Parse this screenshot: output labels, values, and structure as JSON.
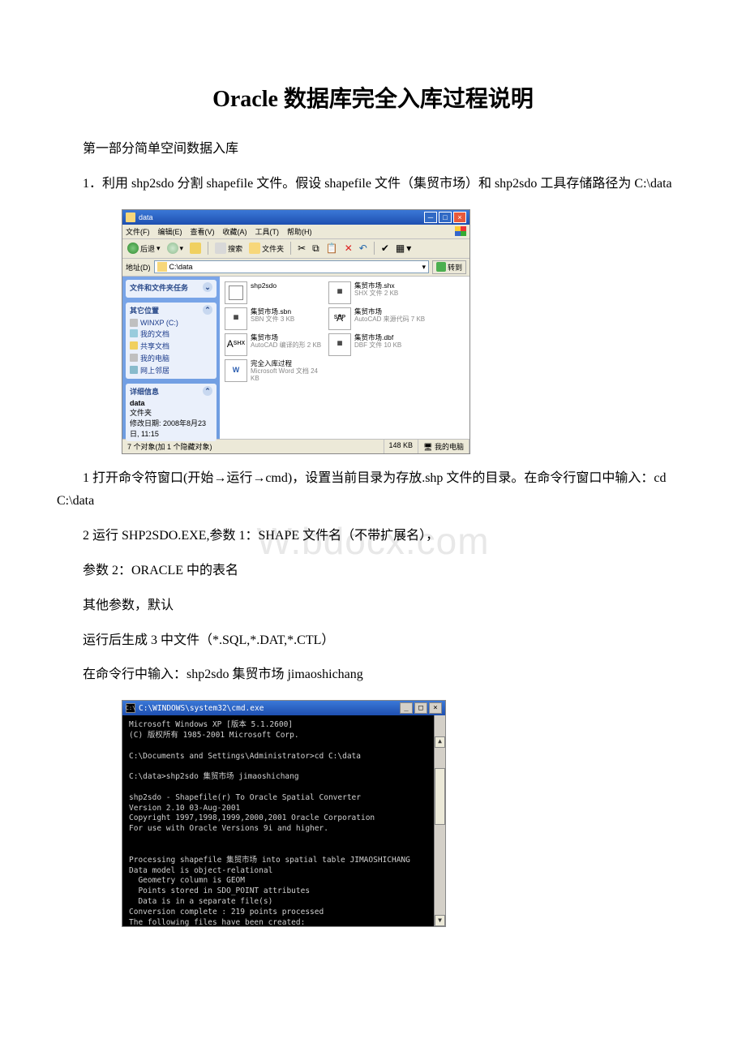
{
  "title": "Oracle 数据库完全入库过程说明",
  "section1": "第一部分简单空间数据入库",
  "para1": "1．利用 shp2sdo 分割 shapefile 文件。假设 shapefile 文件（集贸市场）和 shp2sdo 工具存储路径为 C:\\data",
  "para2": "1 打开命令符窗口(开始→运行→cmd)，设置当前目录为存放.shp 文件的目录。在命令行窗口中输入：cd C:\\data",
  "para3": "2 运行 SHP2SDO.EXE,参数 1：SHAPE 文件名（不带扩展名），",
  "para4": "参数 2：ORACLE 中的表名",
  "para5": "其他参数，默认",
  "para6": "运行后生成 3 中文件（*.SQL,*.DAT,*.CTL）",
  "para7": "在命令行中输入：shp2sdo 集贸市场 jimaoshichang",
  "watermark": "W.bdocx.com",
  "explorer": {
    "title": "data",
    "menus": [
      "文件(F)",
      "编辑(E)",
      "查看(V)",
      "收藏(A)",
      "工具(T)",
      "帮助(H)"
    ],
    "tool_back": "后退",
    "tool_search": "搜索",
    "tool_folder": "文件夹",
    "addr_label": "地址(D)",
    "addr_value": "C:\\data",
    "go_label": "转到",
    "side_tasks_hdr": "文件和文件夹任务",
    "side_other_hdr": "其它位置",
    "side_other_items": [
      "WINXP (C:)",
      "我的文档",
      "共享文档",
      "我的电脑",
      "网上邻居"
    ],
    "side_detail_hdr": "详细信息",
    "side_detail_name": "data",
    "side_detail_type": "文件夹",
    "side_detail_mod": "修改日期: 2008年8月23日, 11:15",
    "files": [
      {
        "icon": "exe",
        "name": "shp2sdo",
        "meta": ""
      },
      {
        "icon": "shx",
        "name": "集贸市场.shx",
        "meta": "SHX 文件\n2 KB"
      },
      {
        "icon": "sbn",
        "name": "集贸市场.sbn",
        "meta": "SBN 文件\n3 KB"
      },
      {
        "icon": "shp",
        "name": "集贸市场",
        "meta": "AutoCAD 来源代码\n7 KB",
        "badge": "SHP"
      },
      {
        "icon": "shx",
        "name": "集贸市场",
        "meta": "AutoCAD 编译的形\n2 KB",
        "badge": "SHX"
      },
      {
        "icon": "dbf",
        "name": "集贸市场.dbf",
        "meta": "DBF 文件\n10 KB"
      },
      {
        "icon": "doc",
        "name": "完全入库过程",
        "meta": "Microsoft Word 文档\n24 KB"
      }
    ],
    "status_left": "7 个对象(加 1 个隐藏对象)",
    "status_size": "148 KB",
    "status_loc_icon": "我的电脑"
  },
  "cmd": {
    "title": "C:\\WINDOWS\\system32\\cmd.exe",
    "body": "Microsoft Windows XP [版本 5.1.2600]\n(C) 版权所有 1985-2001 Microsoft Corp.\n\nC:\\Documents and Settings\\Administrator>cd C:\\data\n\nC:\\data>shp2sdo 集贸市场 jimaoshichang\n\nshp2sdo - Shapefile(r) To Oracle Spatial Converter\nVersion 2.10 03-Aug-2001\nCopyright 1997,1998,1999,2000,2001 Oracle Corporation\nFor use with Oracle Versions 9i and higher.\n\n\nProcessing shapefile 集贸市场 into spatial table JIMAOSHICHANG\nData model is object-relational\n  Geometry column is GEOM\n  Points stored in SDO_POINT attributes\n  Data is in a separate file(s)\nConversion complete : 219 points processed\nThe following files have been created:\n  jimaoshichang.sql :   SQL script to create the table\n  jimaoshichang.ctl :   Control file for loading the table\n  jimaoshichang.dat :   Data file\n\nC:\\data>_"
  }
}
